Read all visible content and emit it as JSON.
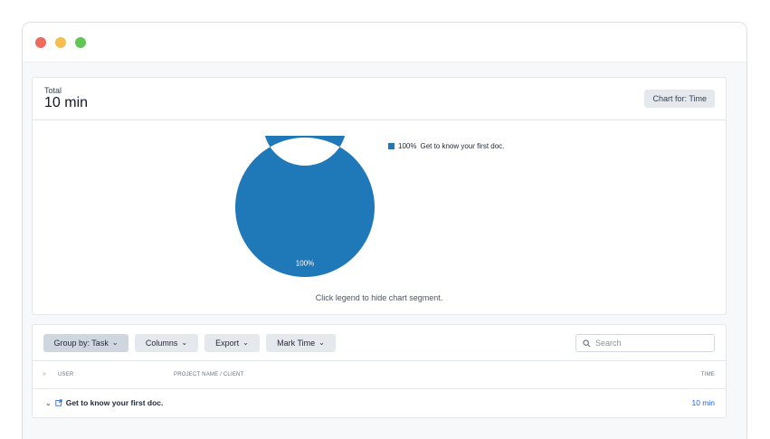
{
  "summary": {
    "total_label": "Total",
    "total_value": "10 min",
    "chart_for_label": "Chart for: Time",
    "chart_hint": "Click legend to hide chart segment."
  },
  "chart_data": {
    "type": "pie",
    "categories": [
      "Get to know your first doc."
    ],
    "values": [
      100
    ],
    "slice_labels": [
      "100%"
    ],
    "legend": [
      {
        "percent": "100%",
        "label": "Get to know your first doc."
      }
    ],
    "colors": [
      "#1f78b8"
    ],
    "legend_position": "top-right",
    "donut": true
  },
  "toolbar": {
    "group_by_label": "Group by: Task",
    "columns_label": "Columns",
    "export_label": "Export",
    "mark_time_label": "Mark Time",
    "search_placeholder": "Search"
  },
  "table": {
    "headers": {
      "user": "USER",
      "project": "PROJECT NAME / CLIENT",
      "time": "TIME"
    },
    "rows": [
      {
        "task": "Get to know your first doc.",
        "time": "10 min"
      }
    ]
  },
  "icons": {
    "window_controls": [
      "close-dot",
      "minimize-dot",
      "maximize-dot"
    ],
    "search": "search-icon",
    "expand_all": "double-chevron-icon",
    "row_toggle": "chevron-down-icon",
    "task_link": "external-link-icon"
  }
}
